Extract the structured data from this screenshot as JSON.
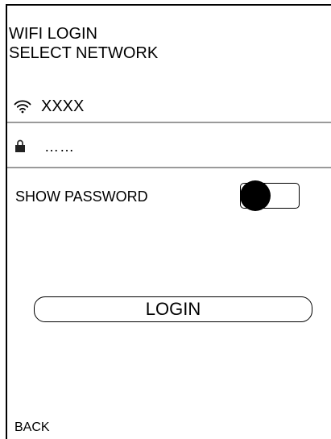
{
  "header": {
    "title": "WIFI LOGIN",
    "subtitle": "SELECT NETWORK"
  },
  "network": {
    "icon": "wifi-icon",
    "name": "XXXX"
  },
  "password": {
    "icon": "lock-icon",
    "value": "……"
  },
  "show_password": {
    "label": "SHOW PASSWORD",
    "enabled": false
  },
  "login": {
    "label": "LOGIN"
  },
  "footer": {
    "back_label": "BACK"
  }
}
